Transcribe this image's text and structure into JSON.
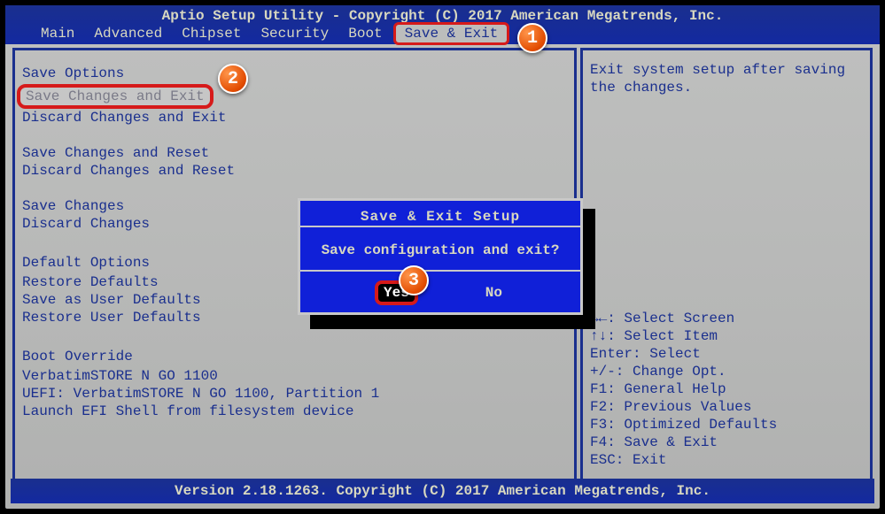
{
  "header": {
    "title": "Aptio Setup Utility - Copyright (C) 2017 American Megatrends, Inc.",
    "tabs": [
      "Main",
      "Advanced",
      "Chipset",
      "Security",
      "Boot",
      "Save & Exit"
    ],
    "active_tab": "Save & Exit"
  },
  "left_pane": {
    "sections": [
      {
        "title": "Save Options",
        "items": [
          "Save Changes and Exit",
          "Discard Changes and Exit"
        ]
      },
      {
        "title": "",
        "items": [
          "Save Changes and Reset",
          "Discard Changes and Reset"
        ]
      },
      {
        "title": "",
        "items": [
          "Save Changes",
          "Discard Changes"
        ]
      },
      {
        "title": "Default Options",
        "items": [
          "Restore Defaults",
          "Save as User Defaults",
          "Restore User Defaults"
        ]
      },
      {
        "title": "Boot Override",
        "items": [
          "VerbatimSTORE N GO 1100",
          "UEFI: VerbatimSTORE N GO 1100, Partition 1",
          "Launch EFI Shell from filesystem device"
        ]
      }
    ]
  },
  "right_pane": {
    "description": "Exit system setup after saving the changes.",
    "help": [
      "→←: Select Screen",
      "↑↓: Select Item",
      "Enter: Select",
      "+/-: Change Opt.",
      "F1: General Help",
      "F2: Previous Values",
      "F3: Optimized Defaults",
      "F4: Save & Exit",
      "ESC: Exit"
    ]
  },
  "dialog": {
    "title": "Save & Exit Setup",
    "question": "Save configuration and exit?",
    "yes": "Yes",
    "no": "No"
  },
  "footer": "Version 2.18.1263. Copyright (C) 2017 American Megatrends, Inc.",
  "callouts": {
    "b1": "1",
    "b2": "2",
    "b3": "3"
  }
}
